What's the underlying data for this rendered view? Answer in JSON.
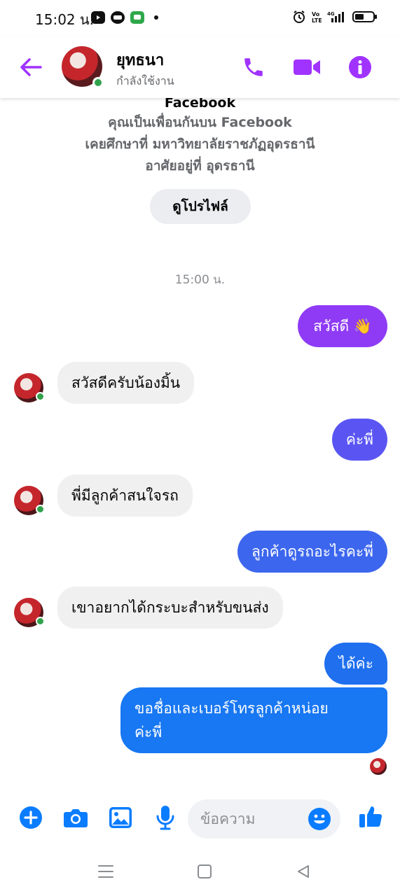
{
  "status_bar": {
    "time": "15:02 น.",
    "icons": [
      "youtube-icon",
      "line-icon",
      "messages-icon",
      "notification-dot",
      "alarm-icon",
      "volte-icon",
      "signal-4g-icon",
      "battery-icon"
    ]
  },
  "header": {
    "contact_name": "ยุทธนา",
    "contact_status": "กำลังใช้งาน",
    "actions": [
      "back-arrow-icon",
      "phone-icon",
      "video-camera-icon",
      "info-icon"
    ],
    "accent_color": "#a033ff"
  },
  "profile_info": {
    "title": "Facebook",
    "friends_line": "คุณเป็นเพื่อนกันบน Facebook",
    "studied_line": "เคยศึกษาที่ มหาวิทยาลัยราชภัฏอุดรธานี",
    "lives_line": "อาศัยอยู่ที่ อุดรธานี",
    "view_profile_button": "ดูโปรไฟล์"
  },
  "timestamp": "15:00 น.",
  "messages": [
    {
      "direction": "out",
      "text": "สวัสดี 👋",
      "color": "#8f3bf5"
    },
    {
      "direction": "in",
      "text": "สวัสดีครับน้องมิ้น"
    },
    {
      "direction": "out",
      "text": "ค่ะพี่",
      "color": "#5a55f2"
    },
    {
      "direction": "in",
      "text": "พี่มีลูกค้าสนใจรถ"
    },
    {
      "direction": "out",
      "text": "ลูกค้าดูรถอะไรคะพี่",
      "color": "#3c66ee"
    },
    {
      "direction": "in",
      "text": "เขาอยากได้กระบะสำหรับขนส่ง"
    },
    {
      "direction": "out",
      "text": "ได้ค่ะ",
      "color": "#1f6fee"
    },
    {
      "direction": "out",
      "text": "ขอชื่อและเบอร์โทรลูกค้าหน่อยค่ะพี่",
      "text_line1": "ขอชื่อและเบอร์โทรลูกค้าหน่อย",
      "text_line2": "ค่ะพี่",
      "color": "#1877f2"
    }
  ],
  "composer": {
    "placeholder": "ข้อความ",
    "buttons": [
      "plus-circle-icon",
      "camera-icon",
      "gallery-icon",
      "microphone-icon",
      "emoji-icon",
      "thumbs-up-icon"
    ],
    "icon_color": "#0a7cff"
  },
  "nav_bar": {
    "buttons": [
      "recent-apps-icon",
      "home-icon",
      "back-icon"
    ]
  }
}
